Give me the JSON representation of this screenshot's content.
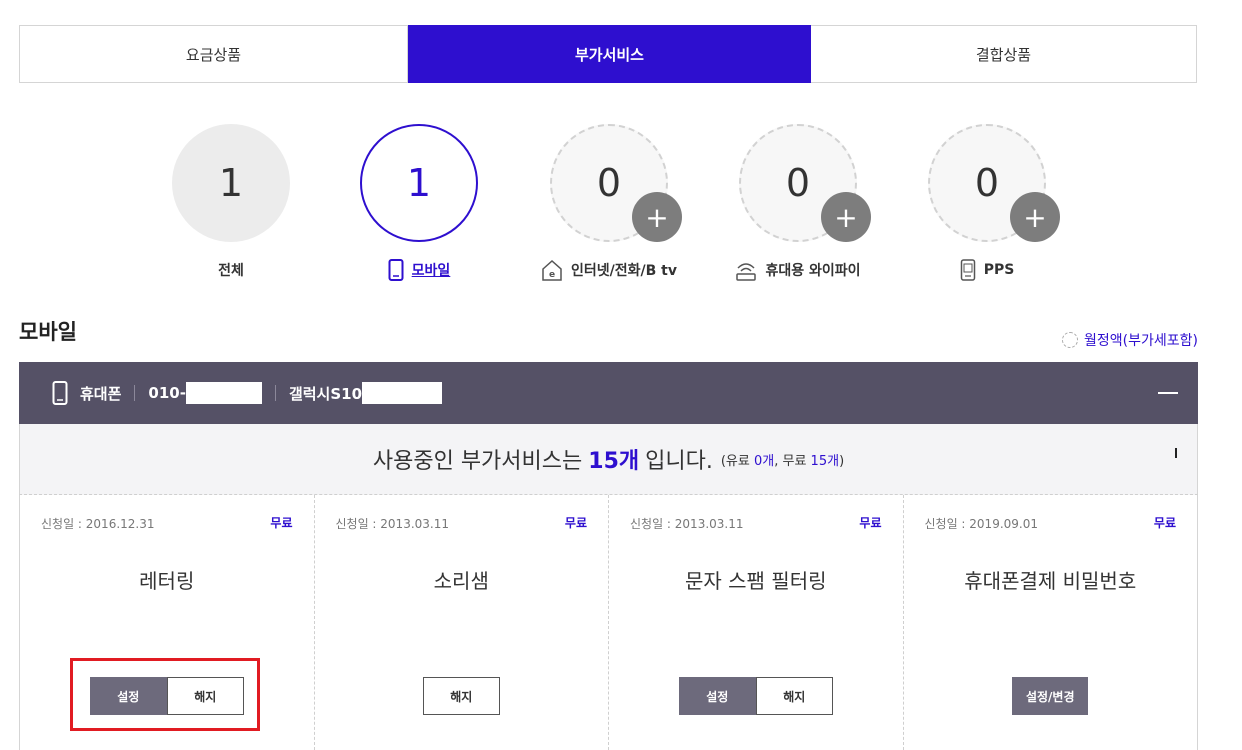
{
  "tabs": [
    {
      "label": "요금상품"
    },
    {
      "label": "부가서비스"
    },
    {
      "label": "결합상품"
    }
  ],
  "categories": [
    {
      "count": "1",
      "label": "전체"
    },
    {
      "count": "1",
      "label": "모바일"
    },
    {
      "count": "0",
      "label": "인터넷/전화/B tv"
    },
    {
      "count": "0",
      "label": "휴대용 와이파이"
    },
    {
      "count": "0",
      "label": "PPS"
    }
  ],
  "section": {
    "title": "모바일",
    "monthly_label": "월정액(부가세포함)"
  },
  "device": {
    "type": "휴대폰",
    "number_prefix": "010-",
    "model_prefix": "갤럭시S10"
  },
  "summary": {
    "prefix": "사용중인 부가서비스는",
    "count": "15개",
    "suffix": "입니다.",
    "detail_open": "(유료",
    "paid_count": "0개",
    "detail_mid": ", 무료",
    "free_count": "15개",
    "detail_close": ")"
  },
  "services": [
    {
      "date": "신청일 : 2016.12.31",
      "fee": "무료",
      "name": "레터링",
      "btn1": "설정",
      "btn2": "해지"
    },
    {
      "date": "신청일 : 2013.03.11",
      "fee": "무료",
      "name": "소리샘",
      "btn1": "해지"
    },
    {
      "date": "신청일 : 2013.03.11",
      "fee": "무료",
      "name": "문자 스팸 필터링",
      "btn1": "설정",
      "btn2": "해지"
    },
    {
      "date": "신청일 : 2019.09.01",
      "fee": "무료",
      "name": "휴대폰결제 비밀번호",
      "btn1": "설정/변경"
    }
  ],
  "colors": {
    "accent": "#2e0fcf",
    "device_bar": "#555166",
    "highlight": "#e11b22"
  }
}
